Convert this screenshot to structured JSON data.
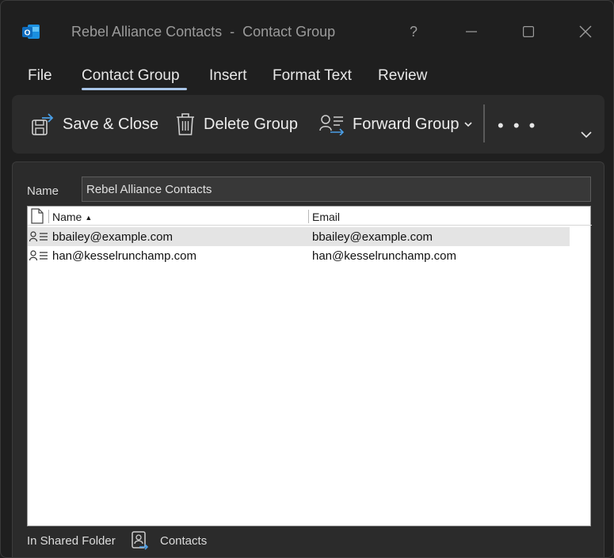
{
  "window": {
    "title": "Rebel Alliance Contacts  -  Contact Group",
    "help_label": "?",
    "minimize_label": "—",
    "maximize_label": "▢",
    "close_label": "✕"
  },
  "tabs": [
    {
      "label": "File",
      "active": false
    },
    {
      "label": "Contact Group",
      "active": true
    },
    {
      "label": "Insert",
      "active": false
    },
    {
      "label": "Format Text",
      "active": false
    },
    {
      "label": "Review",
      "active": false
    }
  ],
  "ribbon": {
    "save_close_label": "Save & Close",
    "delete_group_label": "Delete Group",
    "forward_group_label": "Forward Group",
    "more_label": "• • •",
    "accent_color": "#4a9ee6"
  },
  "form": {
    "name_label": "Name",
    "name_value": "Rebel Alliance Contacts"
  },
  "members": {
    "columns": {
      "name": "Name",
      "email": "Email"
    },
    "sort_indicator": "▲",
    "rows": [
      {
        "name": "bbailey@example.com",
        "email": "bbailey@example.com",
        "selected": true
      },
      {
        "name": "han@kesselrunchamp.com",
        "email": "han@kesselrunchamp.com",
        "selected": false
      }
    ]
  },
  "footer": {
    "label": "In Shared Folder",
    "folder": "Contacts"
  }
}
